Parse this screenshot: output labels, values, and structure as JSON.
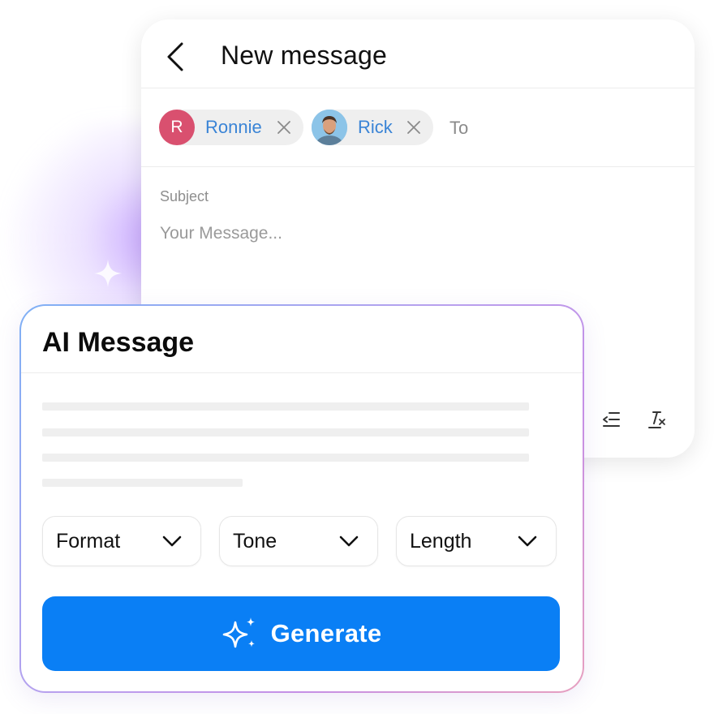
{
  "compose": {
    "title": "New message",
    "recipients": [
      {
        "name": "Ronnie",
        "initial": "R",
        "avatar_color": "#d9506f"
      },
      {
        "name": "Rick",
        "avatar": "photo"
      }
    ],
    "to_label": "To",
    "subject_placeholder": "Subject",
    "message_placeholder": "Your Message...",
    "toolbar_icons": [
      "outdent-icon",
      "clear-format-icon"
    ]
  },
  "ai_message": {
    "title": "AI Message",
    "dropdowns": [
      {
        "label": "Format"
      },
      {
        "label": "Tone"
      },
      {
        "label": "Length"
      }
    ],
    "generate_label": "Generate"
  },
  "colors": {
    "accent": "#0a7ff5",
    "chip_text": "#3a84d6",
    "chip_bg": "#efefef"
  }
}
